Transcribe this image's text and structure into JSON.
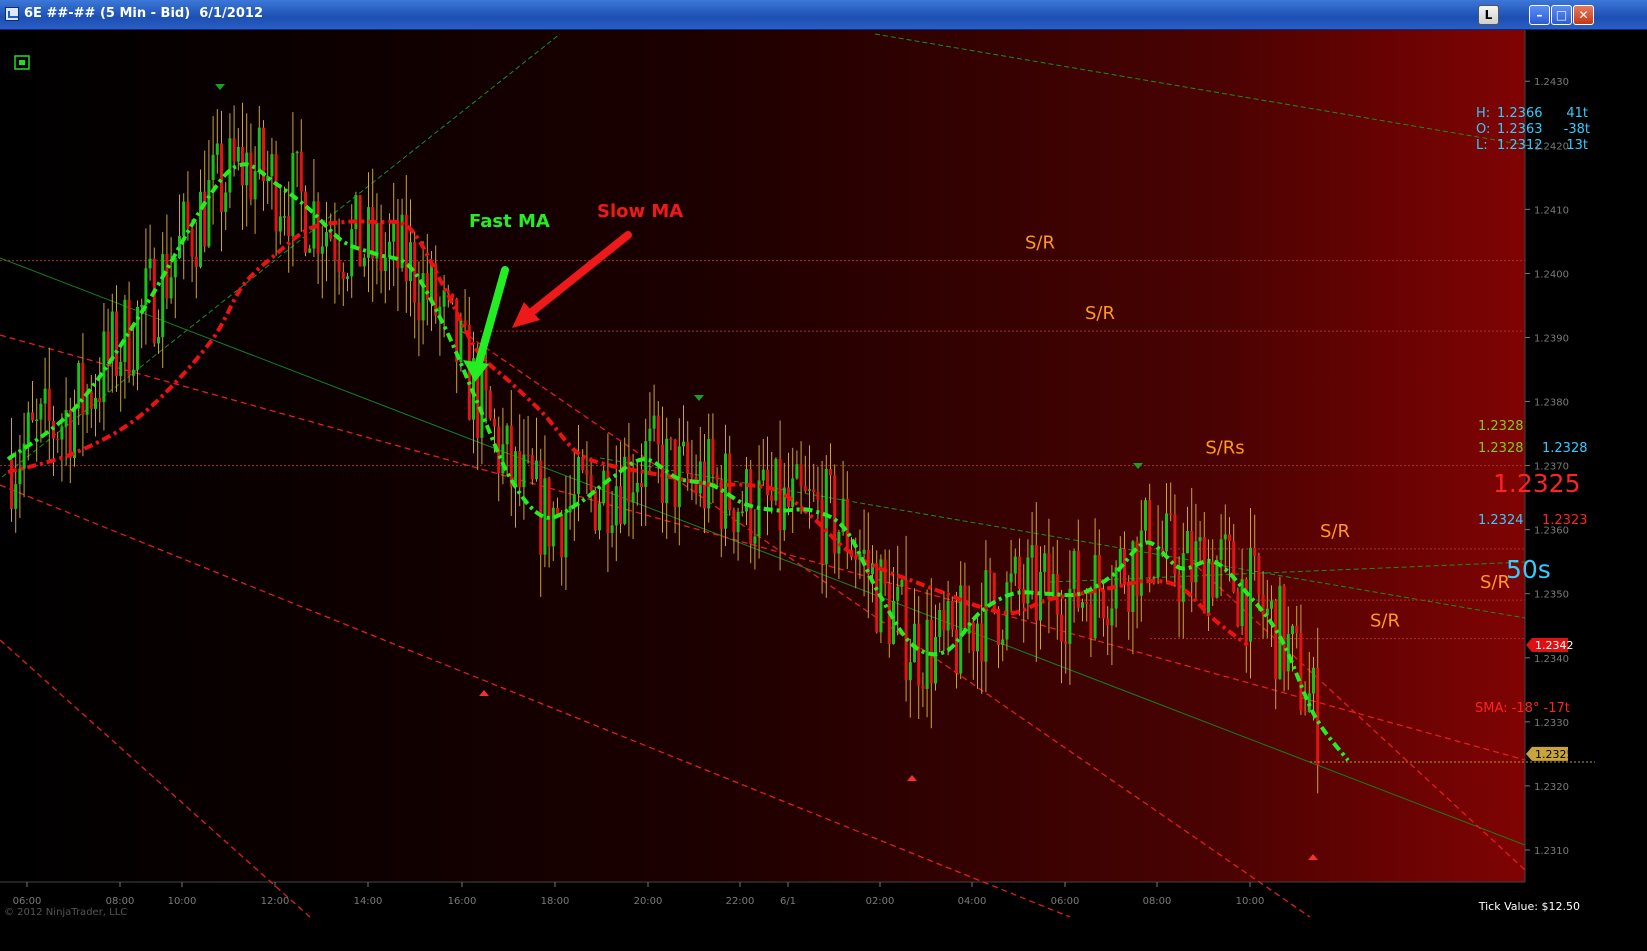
{
  "window": {
    "title": "6E ##-## (5 Min - Bid)  6/1/2012",
    "buttons": {
      "lock": "L",
      "minimize": "–",
      "maximize": "□",
      "close": "✕"
    }
  },
  "ohlc_box": {
    "lines": [
      {
        "label": "H:",
        "price": "1.2366",
        "ticks": "41t"
      },
      {
        "label": "O:",
        "price": "1.2363",
        "ticks": "-38t"
      },
      {
        "label": "L:",
        "price": "1.2312",
        "ticks": "13t"
      }
    ]
  },
  "price_panel": {
    "top": "1.2328",
    "left2": "1.2328",
    "right2": "1.2328",
    "big": "1.2325",
    "bid": "1.2324",
    "ask": "1.2323",
    "timer": "50s"
  },
  "sma_label": "SMA: -18°  -17t",
  "tick_value": "Tick Value: $12.50",
  "copyright": "© 2012 NinjaTrader, LLC",
  "annotations": {
    "fast_ma": "Fast MA",
    "slow_ma": "Slow MA"
  },
  "colors": {
    "up": "#19c219",
    "down": "#e01414",
    "fast_ma": "#22ee22",
    "slow_ma": "#ee1111",
    "sr": "#ff9a1a",
    "axis_text": "#7a7a7a",
    "cyan": "#33ccff"
  },
  "chart_data": {
    "type": "candlestick",
    "title": "6E ##-## (5 Min - Bid)  6/1/2012",
    "interval": "5 Min",
    "ylim": [
      1.2305,
      1.2438
    ],
    "y_ticks": [
      "1.2430",
      "1.2420",
      "1.2410",
      "1.2400",
      "1.2390",
      "1.2380",
      "1.2370",
      "1.2360",
      "1.2350",
      "1.2340",
      "1.2330",
      "1.2320",
      "1.2310"
    ],
    "x_ticks": [
      "06:00",
      "08:00",
      "10:00",
      "12:00",
      "14:00",
      "16:00",
      "18:00",
      "20:00",
      "22:00",
      "6/1",
      "02:00",
      "04:00",
      "06:00",
      "08:00",
      "10:00"
    ],
    "fast_ma": [
      [
        0,
        1.2371
      ],
      [
        2,
        1.2379
      ],
      [
        4,
        1.2394
      ],
      [
        6,
        1.2412
      ],
      [
        7,
        1.2417
      ],
      [
        8,
        1.2414
      ],
      [
        9,
        1.241
      ],
      [
        10,
        1.2405
      ],
      [
        11,
        1.2403
      ],
      [
        12,
        1.2401
      ],
      [
        13,
        1.2392
      ],
      [
        14,
        1.238
      ],
      [
        15,
        1.2368
      ],
      [
        16,
        1.2362
      ],
      [
        17,
        1.2364
      ],
      [
        18,
        1.2368
      ],
      [
        19,
        1.2371
      ],
      [
        20,
        1.2368
      ],
      [
        21,
        1.2367
      ],
      [
        22,
        1.2364
      ],
      [
        23,
        1.2363
      ],
      [
        24,
        1.2363
      ],
      [
        25,
        1.236
      ],
      [
        26,
        1.235
      ],
      [
        27,
        1.2342
      ],
      [
        28,
        1.2341
      ],
      [
        29,
        1.2347
      ],
      [
        30,
        1.235
      ],
      [
        31,
        1.235
      ],
      [
        32,
        1.235
      ],
      [
        33,
        1.2353
      ],
      [
        34,
        1.2358
      ],
      [
        35,
        1.2354
      ],
      [
        36,
        1.2355
      ],
      [
        37,
        1.235
      ],
      [
        38,
        1.2343
      ],
      [
        39,
        1.2331
      ],
      [
        40,
        1.2324
      ]
    ],
    "slow_ma": [
      [
        0,
        1.2369
      ],
      [
        2,
        1.2372
      ],
      [
        4,
        1.2378
      ],
      [
        6,
        1.2389
      ],
      [
        7,
        1.2398
      ],
      [
        8,
        1.2403
      ],
      [
        9,
        1.2407
      ],
      [
        10,
        1.2408
      ],
      [
        11,
        1.2408
      ],
      [
        12,
        1.2407
      ],
      [
        13,
        1.2398
      ],
      [
        14,
        1.2388
      ],
      [
        15,
        1.2383
      ],
      [
        16,
        1.2378
      ],
      [
        17,
        1.2372
      ],
      [
        18,
        1.237
      ],
      [
        19,
        1.2369
      ],
      [
        20,
        1.2368
      ],
      [
        21,
        1.2367
      ],
      [
        22,
        1.2367
      ],
      [
        23,
        1.2366
      ],
      [
        24,
        1.2362
      ],
      [
        25,
        1.2357
      ],
      [
        26,
        1.2354
      ],
      [
        27,
        1.2352
      ],
      [
        28,
        1.235
      ],
      [
        29,
        1.2348
      ],
      [
        30,
        1.2347
      ],
      [
        31,
        1.2349
      ],
      [
        32,
        1.235
      ],
      [
        33,
        1.2351
      ],
      [
        34,
        1.2352
      ],
      [
        35,
        1.2351
      ],
      [
        36,
        1.2346
      ],
      [
        37,
        1.2342
      ]
    ],
    "sr_levels": [
      {
        "label": "S/R",
        "price": 1.2402
      },
      {
        "label": "S/R",
        "price": 1.2391
      },
      {
        "label": "S/Rs",
        "price": 1.237
      },
      {
        "label": "S/R",
        "price": 1.2357
      },
      {
        "label": "S/R",
        "price": 1.2349
      },
      {
        "label": "S/R",
        "price": 1.2343
      }
    ],
    "current_price": 1.2342,
    "last_price": 1.2325,
    "high_price": 1.2366,
    "low_price": 1.2312
  }
}
